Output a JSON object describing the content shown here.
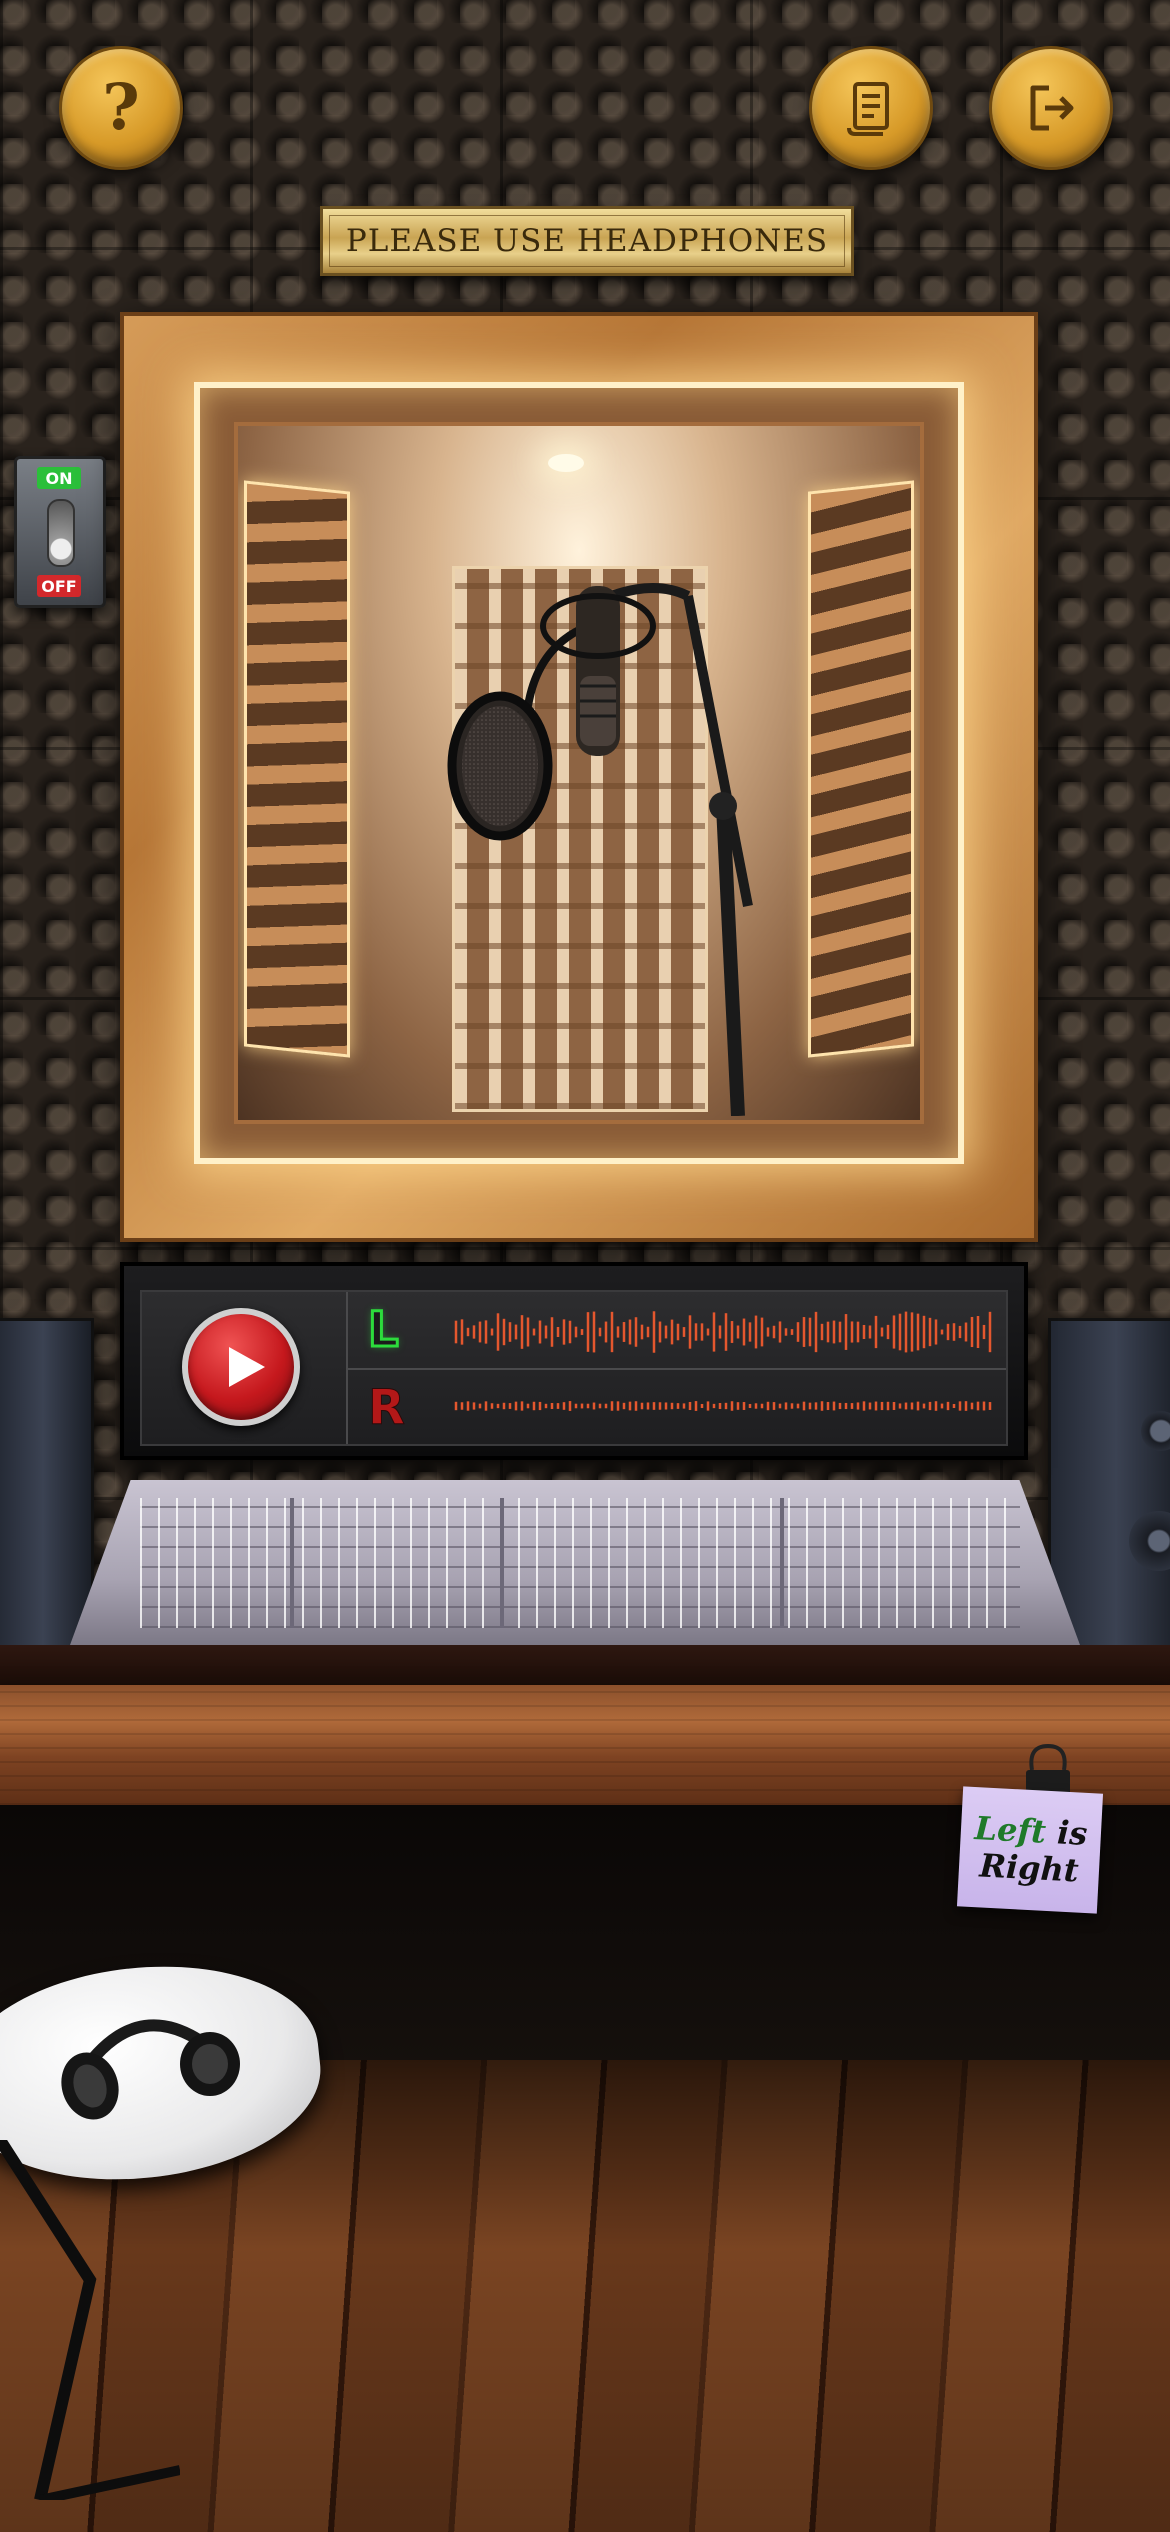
{
  "header": {
    "help_button": {
      "icon": "question-mark-icon",
      "label": "?"
    },
    "script_button": {
      "icon": "script-scroll-icon"
    },
    "exit_button": {
      "icon": "exit-door-icon"
    }
  },
  "plaque": {
    "text": "PLEASE USE HEADPHONES"
  },
  "power_switch": {
    "on_label": "ON",
    "off_label": "OFF",
    "state": "on"
  },
  "player": {
    "play_icon": "play-icon",
    "left_channel_label": "L",
    "right_channel_label": "R",
    "left_channel_color": "#2cdb3c",
    "right_channel_color": "#b31818",
    "waveform_color": "#e4572e"
  },
  "sticky_note": {
    "word1": "Left",
    "word2": "is",
    "word3": "Right"
  },
  "colors": {
    "button_gold": "#d79a28",
    "play_red": "#c5181d",
    "booth_glow": "#fff1c9"
  }
}
